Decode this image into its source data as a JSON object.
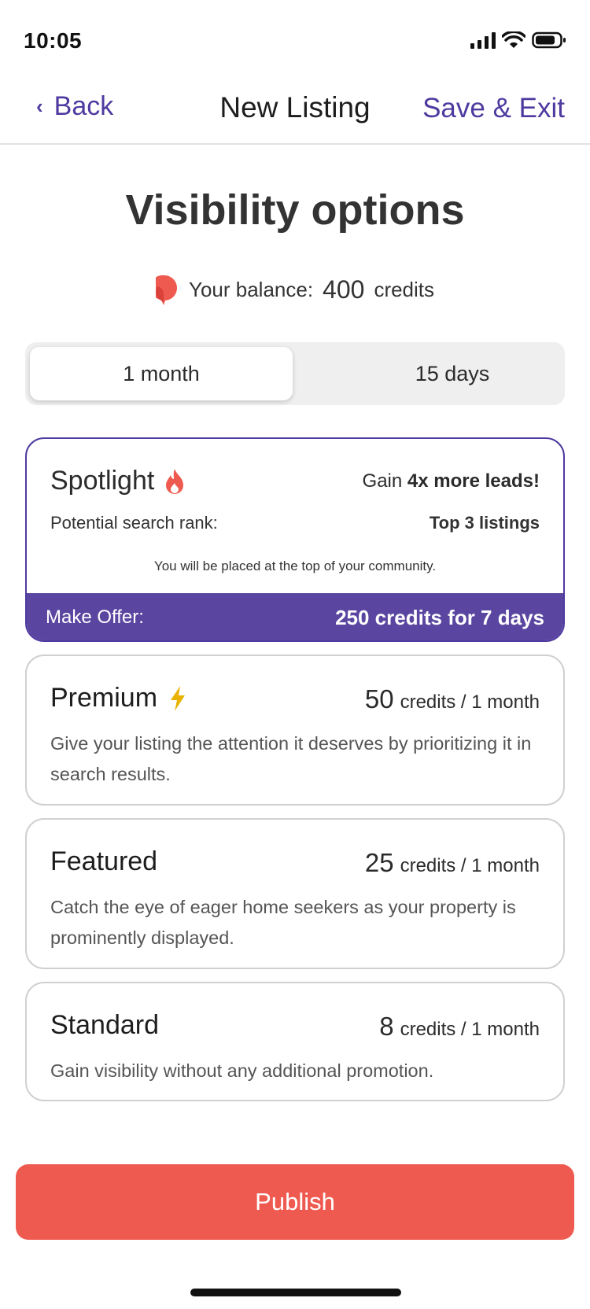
{
  "status_bar": {
    "time": "10:05",
    "icons": [
      "signal-icon",
      "wifi-icon",
      "battery-icon"
    ]
  },
  "nav": {
    "back_label": "Back",
    "title": "New Listing",
    "save_exit_label": "Save & Exit"
  },
  "page": {
    "title": "Visibility options"
  },
  "balance": {
    "label": "Your balance:",
    "amount": "400",
    "unit": "credits"
  },
  "duration_tabs": {
    "options": [
      "1 month",
      "15 days"
    ],
    "selected": "1 month"
  },
  "spotlight": {
    "name": "Spotlight",
    "gain_prefix": "Gain ",
    "gain_bold": "4x more leads!",
    "rank_label": "Potential search rank:",
    "rank_value": "Top 3 listings",
    "note": "You will be placed at the top of your community.",
    "offer_label": "Make Offer:",
    "offer_value": "250 credits for 7 days"
  },
  "tiers": [
    {
      "name": "Premium",
      "price": "50",
      "price_suffix": "credits / 1 month",
      "description": "Give your listing the attention it deserves by prioritizing it in search results."
    },
    {
      "name": "Featured",
      "price": "25",
      "price_suffix": "credits / 1 month",
      "description": "Catch the eye of eager home seekers as your property is prominently displayed."
    },
    {
      "name": "Standard",
      "price": "8",
      "price_suffix": "credits / 1 month",
      "description": "Gain visibility without any additional promotion."
    }
  ],
  "publish_label": "Publish",
  "colors": {
    "accent": "#4f3aa0",
    "offer_bar": "#5a46a0",
    "publish": "#ef5a50",
    "flame": "#ef5a50",
    "bolt": "#e9b200"
  }
}
